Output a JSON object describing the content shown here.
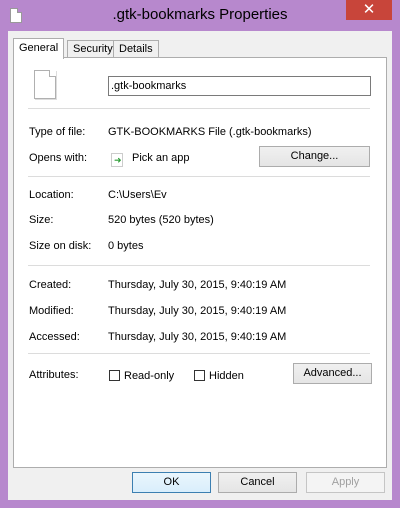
{
  "window": {
    "title": ".gtk-bookmarks Properties",
    "close_glyph": "✕"
  },
  "tabs": [
    {
      "label": "General"
    },
    {
      "label": "Security"
    },
    {
      "label": "Details"
    }
  ],
  "general": {
    "file_name": ".gtk-bookmarks",
    "type_label": "Type of file:",
    "type_value": "GTK-BOOKMARKS File (.gtk-bookmarks)",
    "opens_label": "Opens with:",
    "opens_value": "Pick an app",
    "change_button": "Change...",
    "location_label": "Location:",
    "location_value": "C:\\Users\\Ev",
    "size_label": "Size:",
    "size_value": "520 bytes (520 bytes)",
    "size_on_disk_label": "Size on disk:",
    "size_on_disk_value": "0 bytes",
    "created_label": "Created:",
    "created_value": "Thursday, July 30, 2015, 9:40:19 AM",
    "modified_label": "Modified:",
    "modified_value": "Thursday, July 30, 2015, 9:40:19 AM",
    "accessed_label": "Accessed:",
    "accessed_value": "Thursday, July 30, 2015, 9:40:19 AM",
    "attributes_label": "Attributes:",
    "readonly_label": "Read-only",
    "hidden_label": "Hidden",
    "advanced_button": "Advanced..."
  },
  "footer": {
    "ok": "OK",
    "cancel": "Cancel",
    "apply": "Apply"
  },
  "colors": {
    "frame": "#b788cd",
    "close": "#c8453a",
    "open_arrow": "#2c9c35"
  }
}
